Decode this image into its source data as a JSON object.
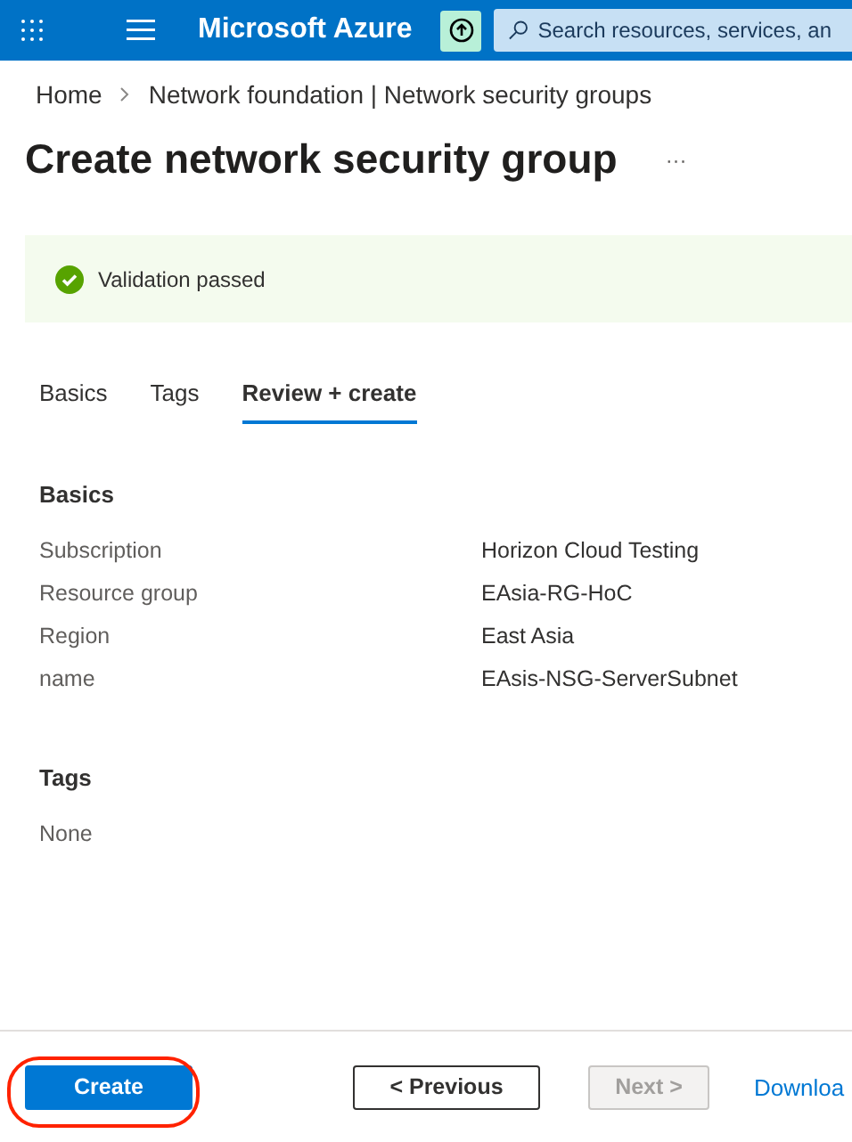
{
  "top_bar": {
    "brand": "Microsoft Azure",
    "search": {
      "placeholder": "Search resources, services, an"
    }
  },
  "breadcrumb": [
    "Home",
    "Network foundation | Network security groups"
  ],
  "title": "Create network security group",
  "more": "···",
  "banner": {
    "kind": "success",
    "text": "Validation passed"
  },
  "tabs": [
    {
      "label": "Basics",
      "selected": false
    },
    {
      "label": "Tags",
      "selected": false
    },
    {
      "label": "Review + create",
      "selected": true
    }
  ],
  "sections": [
    {
      "heading": "Basics",
      "rows": [
        {
          "label": "Subscription",
          "value": "Horizon Cloud Testing"
        },
        {
          "label": "Resource group",
          "value": "EAsia-RG-HoC"
        },
        {
          "label": "Region",
          "value": "East Asia"
        },
        {
          "label": "name",
          "value": "EAsis-NSG-ServerSubnet"
        }
      ]
    },
    {
      "heading": "Tags",
      "rows": [
        {
          "label": "None"
        }
      ]
    }
  ],
  "footer": {
    "buttons": [
      {
        "label": "Create",
        "kind": "primary",
        "disabled": false,
        "highlighted": true
      },
      {
        "label": "< Previous",
        "kind": "secondary",
        "disabled": false,
        "highlighted": false
      },
      {
        "label": "Next >",
        "kind": "secondary",
        "disabled": true,
        "highlighted": false
      },
      {
        "label": "Downloa",
        "kind": "link",
        "disabled": false,
        "highlighted": false
      }
    ]
  }
}
